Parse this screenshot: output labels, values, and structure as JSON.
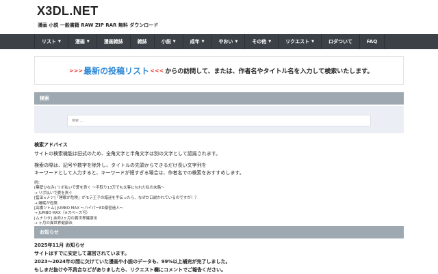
{
  "site": {
    "title": "X3DL.NET",
    "description": "漫画 小説 一般書籍 RAW ZIP RAR 無料 ダウンロード"
  },
  "nav": {
    "items": [
      {
        "label": "リスト",
        "dropdown": true
      },
      {
        "label": "漫画",
        "dropdown": true
      },
      {
        "label": "漫画雑誌",
        "dropdown": false
      },
      {
        "label": "雑誌",
        "dropdown": false
      },
      {
        "label": "小説",
        "dropdown": true
      },
      {
        "label": "成年",
        "dropdown": true
      },
      {
        "label": "やおい",
        "dropdown": true
      },
      {
        "label": "その他",
        "dropdown": true
      },
      {
        "label": "リクエスト",
        "dropdown": true
      },
      {
        "label": "ロダついて",
        "dropdown": false
      },
      {
        "label": "FAQ",
        "dropdown": false
      }
    ],
    "caret_icon": "chevron-down-icon"
  },
  "banner": {
    "arrows_left": ">>>",
    "link_text": "最新の投稿リスト",
    "arrows_right": "<<<",
    "rest_text": "からの訪問して、または、作者名やタイトル名を入力して検索いたします。"
  },
  "search": {
    "section_title": "検索",
    "placeholder": "検索 …"
  },
  "advice": {
    "heading": "検索アドバイス",
    "lines": [
      "サイトの検索機能は旧式のため、全角文字と半角文字は別の文字として認識されます。",
      "検索の際は、記号や数字を除外し、タイトルの先頭からできるだけ長い文字列を",
      "キーワードとして入力すると、キーワードが短すぎる場合は、作者名での検索をおすすめします。"
    ],
    "examples_label": "例：",
    "examples": [
      "[葉壁ひなみ] リボ払いで愛を貢ぐ ～手取り13万でも太客になれた私の末路～",
      "→ リボ払いで愛を貢ぐ",
      "[藍田×ナツ]「睡眠が危険」がモテ王子の錯迷を手伝ったら、なぜか口説かれているのですが！？",
      "→ 睡眠が危険",
      "[高橋ツトム] JUMBO MAX ～ハイパーED薬密造人～",
      "→ JUMBO MAX（※スペース可）",
      "[ムナカタ] 余命2ヶ月の異世界健康法",
      "→ ヶ月の異世界健康法"
    ]
  },
  "news": {
    "section_title": "お知らせ",
    "lines": [
      "2025年11月 お知らせ",
      "サイトはすでに安定して運営されています。",
      "2023〜2024年の間に欠けていた漫画や小説のデータも、99%以上補完が完了しました。",
      "もしまだ抜けや不具合などがありましたら、リクエスト欄にコメントでご報告ください。"
    ]
  },
  "colors": {
    "nav_bg": "#3b4147",
    "section_bar": "#9da8b0",
    "search_panel": "#eceef5",
    "banner_link": "#2a86d4",
    "banner_arrows": "#e03a2e"
  }
}
